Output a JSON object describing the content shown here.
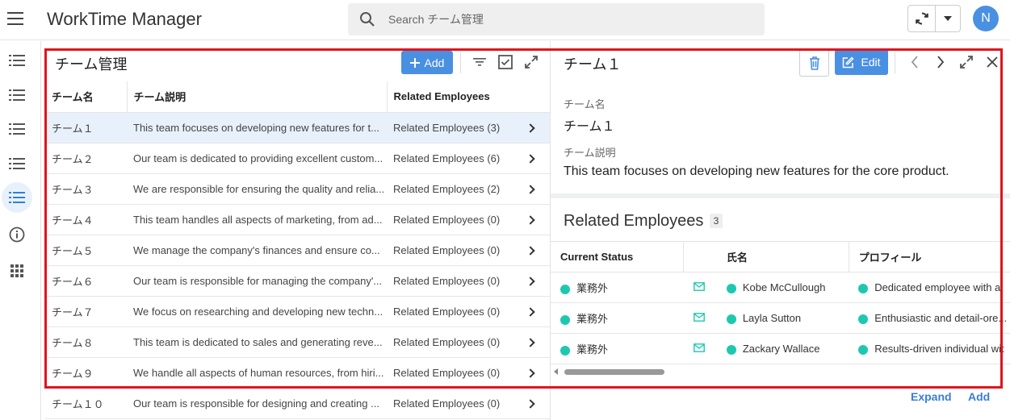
{
  "header": {
    "app_title": "WorkTime Manager",
    "search_placeholder": "Search チーム管理",
    "avatar_initial": "N"
  },
  "left_panel": {
    "title": "チーム管理",
    "add_label": "Add",
    "columns": [
      "チーム名",
      "チーム説明",
      "Related Employees"
    ],
    "rows": [
      {
        "name": "チーム１",
        "description": "This team focuses on developing new features for t...",
        "related": "Related Employees (3)"
      },
      {
        "name": "チーム２",
        "description": "Our team is dedicated to providing excellent custom...",
        "related": "Related Employees (6)"
      },
      {
        "name": "チーム３",
        "description": "We are responsible for ensuring the quality and relia...",
        "related": "Related Employees (2)"
      },
      {
        "name": "チーム４",
        "description": "This team handles all aspects of marketing, from ad...",
        "related": "Related Employees (0)"
      },
      {
        "name": "チーム５",
        "description": "We manage the company's finances and ensure co...",
        "related": "Related Employees (0)"
      },
      {
        "name": "チーム６",
        "description": "Our team is responsible for managing the company'...",
        "related": "Related Employees (0)"
      },
      {
        "name": "チーム７",
        "description": "We focus on researching and developing new techn...",
        "related": "Related Employees (0)"
      },
      {
        "name": "チーム８",
        "description": "This team is dedicated to sales and generating reve...",
        "related": "Related Employees (0)"
      },
      {
        "name": "チーム９",
        "description": "We handle all aspects of human resources, from hiri...",
        "related": "Related Employees (0)"
      },
      {
        "name": "チーム１０",
        "description": "Our team is responsible for designing and creating ...",
        "related": "Related Employees (0)"
      }
    ]
  },
  "detail": {
    "title": "チーム１",
    "edit_label": "Edit",
    "name_label": "チーム名",
    "name_value": "チーム１",
    "desc_label": "チーム説明",
    "desc_value": "This team focuses on developing new features for the core product.",
    "related_title": "Related Employees",
    "related_count": "3",
    "emp_columns": [
      "Current Status",
      "氏名",
      "プロフィール"
    ],
    "employees": [
      {
        "status": "業務外",
        "name": "Kobe McCullough",
        "profile": "Dedicated employee with a"
      },
      {
        "status": "業務外",
        "name": "Layla Sutton",
        "profile": "Enthusiastic and detail-ore..."
      },
      {
        "status": "業務外",
        "name": "Zackary Wallace",
        "profile": "Results-driven individual wit"
      }
    ],
    "expand_label": "Expand",
    "add_label": "Add"
  },
  "colors": {
    "accent": "#4a90e2",
    "status_dot": "#1ec8b0",
    "highlight": "#e0141e",
    "selected_row": "#e8f1fb"
  }
}
